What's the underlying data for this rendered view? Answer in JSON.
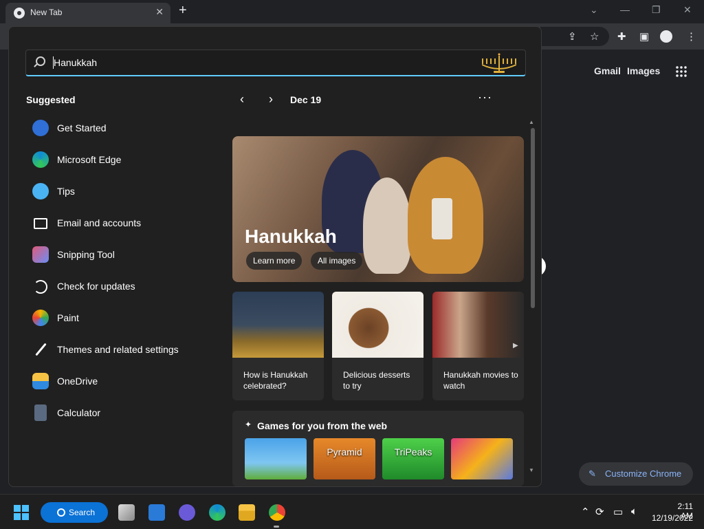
{
  "chrome": {
    "tab_title": "New Tab",
    "tab_close": "✕",
    "new_tab": "+",
    "window_controls": [
      "⌄",
      "—",
      "❐",
      "✕"
    ],
    "toolbar_icons": [
      "share-icon",
      "star-icon",
      "extensions-icon",
      "sidepanel-icon",
      "profile-icon",
      "menu-icon"
    ],
    "links": {
      "gmail": "Gmail",
      "images": "Images"
    },
    "customize_label": "Customize Chrome"
  },
  "start_panel": {
    "search": {
      "value": "Hanukkah"
    },
    "suggested_title": "Suggested",
    "apps": [
      {
        "label": "Get Started",
        "color": "#3b82f6"
      },
      {
        "label": "Microsoft Edge",
        "color": "#1fa0e0"
      },
      {
        "label": "Tips",
        "color": "#4ab3f4"
      },
      {
        "label": "Email and accounts",
        "color": "#ffffff"
      },
      {
        "label": "Snipping Tool",
        "color": "#e05a7a"
      },
      {
        "label": "Check for updates",
        "color": "#ffffff"
      },
      {
        "label": "Paint",
        "color": "#f4b400"
      },
      {
        "label": "Themes and related settings",
        "color": "#ffffff"
      },
      {
        "label": "OneDrive",
        "color": "#f6c344"
      },
      {
        "label": "Calculator",
        "color": "#5a8fd8"
      }
    ],
    "date_label": "Dec 19",
    "more": "···",
    "hero": {
      "title": "Hanukkah",
      "learn_more": "Learn more",
      "all_images": "All images"
    },
    "cards": [
      {
        "text": "How is Hanukkah celebrated?"
      },
      {
        "text": "Delicious desserts to try"
      },
      {
        "text": "Hanukkah movies to watch"
      }
    ],
    "games": {
      "title": "Games for you from the web",
      "tiles": [
        {
          "label": ""
        },
        {
          "label": "Pyramid"
        },
        {
          "label": "TriPeaks"
        },
        {
          "label": ""
        }
      ]
    }
  },
  "taskbar": {
    "search_label": "Search",
    "time": "2:11 AM",
    "date": "12/19/2022"
  }
}
